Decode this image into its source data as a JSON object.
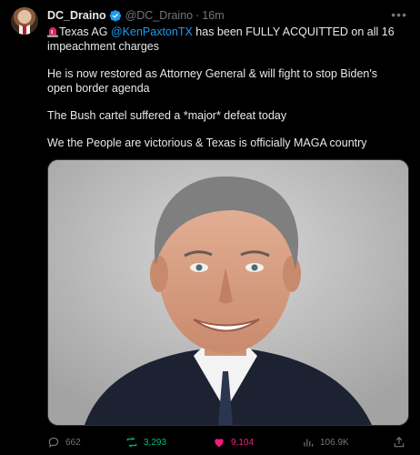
{
  "author": {
    "display_name": "DC_Draino",
    "handle": "@DC_Draino",
    "separator": "·",
    "time": "16m"
  },
  "tweet": {
    "line1_pre": "Texas AG ",
    "line1_mention": "@KenPaxtonTX",
    "line1_post": " has been FULLY ACQUITTED on all 16 impeachment charges",
    "para2": "He is now restored as Attorney General & will fight to stop Biden's open border agenda",
    "para3": "The Bush cartel suffered a *major* defeat today",
    "para4": "We the People are victorious & Texas is officially MAGA country"
  },
  "stats": {
    "replies": "662",
    "retweets": "3,293",
    "likes": "9,104",
    "views": "106.9K"
  },
  "icons": {
    "more": "more-options-icon",
    "verified": "verified-badge-icon",
    "siren": "siren-emoji-icon",
    "reply": "reply-icon",
    "retweet": "retweet-icon",
    "like": "heart-icon",
    "views": "views-icon",
    "share": "share-icon"
  },
  "colors": {
    "background": "#000000",
    "text": "#e7e9ea",
    "muted": "#71767b",
    "link": "#1d9bf0",
    "retweet": "#00ba7c",
    "like": "#f91880"
  }
}
